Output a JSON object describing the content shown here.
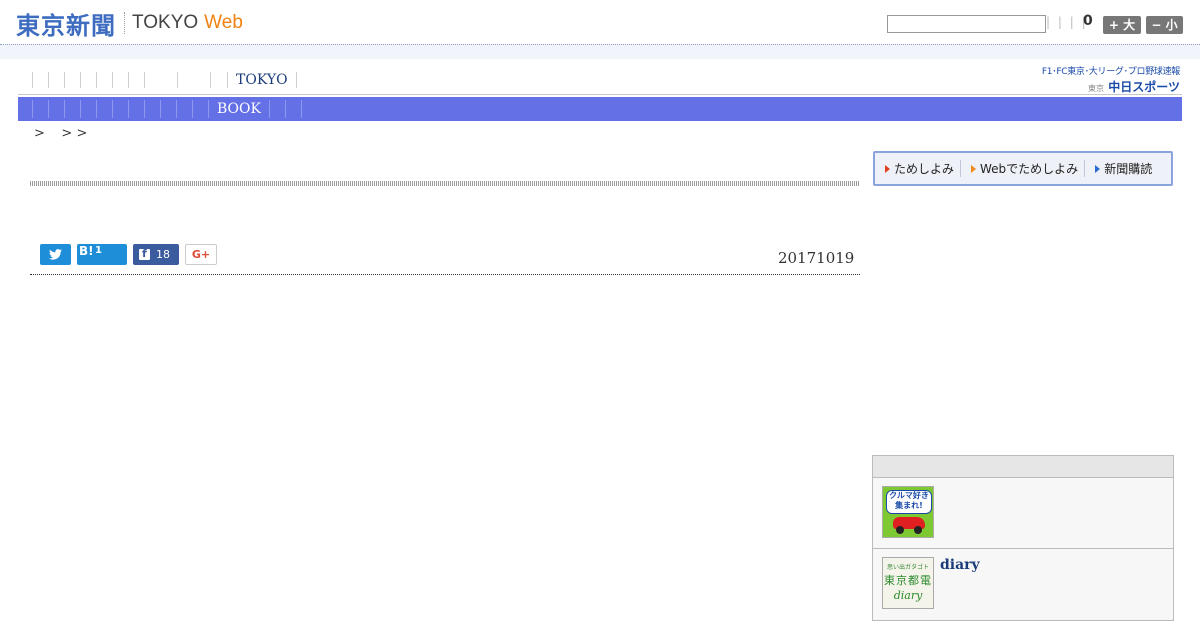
{
  "header": {
    "logo_jp": "東京新聞",
    "logo_en": "TOKYO",
    "logo_web": "Web",
    "search_placeholder": "",
    "util_links": "| | | |",
    "count": "0",
    "btn_large": "+ 大",
    "btn_small": "− 小"
  },
  "gnav": {
    "item": "TOKYO",
    "sports_top": "F1･FC東京･大リーグ･プロ野球速報",
    "sports_small": "東京",
    "sports_name": "中日スポーツ"
  },
  "subnav": {
    "item": "BOOK"
  },
  "breadcrumb": ">    > >",
  "article": {
    "hatebu_label": "B!",
    "hatebu_count": "1",
    "fb_count": "18",
    "gplus_label": "G+",
    "date": "20171019"
  },
  "subscribe": {
    "items": [
      "ためしよみ",
      "Webでためしよみ",
      "新聞購読"
    ]
  },
  "sidebar": {
    "car_bubble": "クルマ好き集まれ!",
    "diary_thumb_top": "思い出ガタゴト",
    "diary_thumb_mid": "東京都電",
    "diary_thumb_bottom": "diary",
    "diary_title": "diary"
  },
  "colors": {
    "brand_blue": "#3d6cc0",
    "web_orange": "#f0820f",
    "subnav_bg": "#6470e6",
    "link_navy": "#1a3d7a",
    "twitter": "#1e8ed8",
    "facebook": "#3b5b9f"
  }
}
